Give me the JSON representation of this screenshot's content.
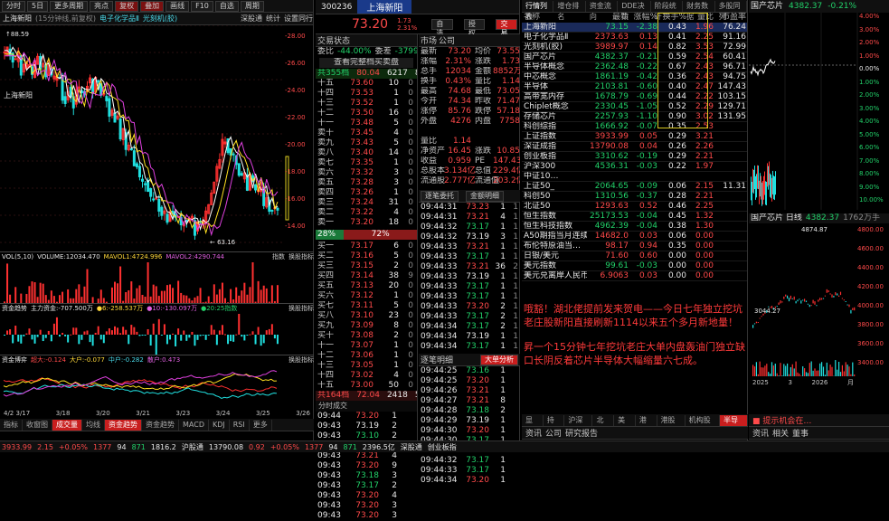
{
  "left": {
    "toolbar": [
      "分时",
      "5日",
      "更多周期",
      "亮点",
      "复权",
      "叠加",
      "画线",
      "F10",
      "自选",
      "周期"
    ],
    "info_tabs": [
      "上海新阳",
      "(15分钟线,前复权)",
      "电子化学品Ⅱ",
      "光刻机(胶)"
    ],
    "right_tabs": [
      "深股通",
      "统计",
      "设置同行",
      "周期"
    ],
    "price_label": "上海新阳",
    "hi_label": "↑88.59",
    "lo_label": "← 63.16",
    "price_axis": [
      "-28.00",
      "-26.00",
      "-24.00",
      "-22.00",
      "-20.00",
      "-18.00",
      "-16.00",
      "-14.00"
    ],
    "vol_header": {
      "a": "VOL(5,10)",
      "b": "VOLUME:12034.470",
      "c": "MAVOL1:4724.996",
      "d": "MAVOL2:4290.744",
      "e": "指数",
      "f": "换股指标"
    },
    "vol_axis": [
      "-10万",
      "-5万",
      "-50"
    ],
    "fund_header": {
      "a": "资金趋势",
      "b": "主力资金:-707.500万",
      "c": "●6:-258.537万",
      "d": "●10:-130.097万",
      "e": "●20:25指数",
      "f": "换股指标"
    },
    "fund_axis": [
      "-1500万",
      "-1000万",
      "-500万",
      "-1000万"
    ],
    "bs_header": {
      "a": "资金博弈",
      "b": "超大:-0.124",
      "c": "大户:-0.077",
      "d": "中户:-0.282",
      "e": "散户:0.473",
      "f": "换股指标"
    },
    "bs_axis": [
      "-0.5",
      "-0.0",
      "-0.5"
    ],
    "dates": [
      "4/2 3/17",
      "3/18",
      "3/20",
      "3/21",
      "3/23",
      "3/24",
      "3/25",
      "3/26"
    ],
    "bottom_tabs": [
      "指标",
      "收窗图",
      "成交量",
      "均线",
      "资金趋势",
      "资金趋势",
      "MACD",
      "KDJ",
      "RSI",
      "更多"
    ]
  },
  "mid": {
    "code": "300236",
    "name": "上海新阳",
    "price": "73.20",
    "chg": "1.73",
    "pct": "2.31%",
    "btn_self": "自选",
    "btn_warn": "授权",
    "btn_trade": "交易",
    "tabs": [
      "交易状态",
      "市场",
      "公司"
    ],
    "weibi": {
      "l": "委比",
      "v": "-44.00%",
      "l2": "委差",
      "v2": "-3799"
    },
    "check_btn": "查看完整档买卖盘",
    "total_sell": {
      "l": "共355档",
      "p": "80.04",
      "v": "6217",
      "n": "8"
    },
    "asks": [
      [
        "十五",
        "73.60",
        "10",
        "0"
      ],
      [
        "十四",
        "73.53",
        "1",
        "0"
      ],
      [
        "十三",
        "73.52",
        "1",
        "0"
      ],
      [
        "十二",
        "73.50",
        "16",
        "0"
      ],
      [
        "十一",
        "73.48",
        "5",
        "0"
      ],
      [
        "卖十",
        "73.45",
        "4",
        "0"
      ],
      [
        "卖九",
        "73.43",
        "5",
        "0"
      ],
      [
        "卖八",
        "73.40",
        "14",
        "0"
      ],
      [
        "卖七",
        "73.35",
        "1",
        "0"
      ],
      [
        "卖六",
        "73.32",
        "3",
        "0"
      ],
      [
        "卖五",
        "73.28",
        "3",
        "0"
      ],
      [
        "卖四",
        "73.26",
        "1",
        "0"
      ],
      [
        "卖三",
        "73.24",
        "31",
        "0"
      ],
      [
        "卖二",
        "73.22",
        "4",
        "0"
      ],
      [
        "卖一",
        "73.20",
        "18",
        "0"
      ]
    ],
    "ratio": {
      "a": "28%",
      "b": "72%"
    },
    "bids": [
      [
        "买一",
        "73.17",
        "6",
        "0"
      ],
      [
        "买二",
        "73.16",
        "5",
        "0"
      ],
      [
        "买三",
        "73.15",
        "2",
        "0"
      ],
      [
        "买四",
        "73.14",
        "38",
        "9"
      ],
      [
        "买五",
        "73.13",
        "20",
        "0"
      ],
      [
        "买六",
        "73.12",
        "1",
        "0"
      ],
      [
        "买七",
        "73.11",
        "5",
        "0"
      ],
      [
        "买八",
        "73.10",
        "23",
        "0"
      ],
      [
        "买九",
        "73.09",
        "8",
        "0"
      ],
      [
        "买十",
        "73.08",
        "2",
        "0"
      ],
      [
        "十一",
        "73.07",
        "1",
        "0"
      ],
      [
        "十二",
        "73.06",
        "1",
        "0"
      ],
      [
        "十三",
        "73.05",
        "1",
        "0"
      ],
      [
        "十四",
        "73.02",
        "4",
        "0"
      ],
      [
        "十五",
        "73.00",
        "50",
        "0"
      ]
    ],
    "total_buy": {
      "l": "共164档",
      "p": "72.04",
      "v": "2418",
      "n": "5"
    },
    "stats": [
      [
        "最新",
        "73.20",
        "均价",
        "73.55"
      ],
      [
        "涨幅",
        "2.31%",
        "涨跌",
        "1.73"
      ],
      [
        "总手",
        "12034",
        "金额",
        "8852万"
      ],
      [
        "换手",
        "0.43%",
        "量比",
        "1.14"
      ],
      [
        "最高",
        "74.68",
        "最低",
        "73.05"
      ],
      [
        "今开",
        "74.34",
        "昨收",
        "71.47"
      ],
      [
        "涨停",
        "85.76",
        "跌停",
        "57.18"
      ],
      [
        "外盘",
        "4276",
        "内盘",
        "7758"
      ],
      [
        "",
        "",
        "",
        ""
      ],
      [
        "量比",
        "1.14",
        "",
        ""
      ],
      [
        "净资产",
        "16.45",
        "涨跌",
        "10.85"
      ],
      [
        "收益",
        "0.959",
        "PE",
        "147.43"
      ],
      [
        "总股本",
        "3.134亿",
        "总值",
        "229.4亿"
      ],
      [
        "流通股",
        "2.777亿",
        "流通值",
        "203.2亿"
      ]
    ],
    "mid_tabs": [
      "逐笔委托",
      "金额明细"
    ],
    "ticks1": [
      [
        "09:44:31",
        "73.23",
        "1",
        "1"
      ],
      [
        "09:44:31",
        "73.21",
        "4",
        "1"
      ],
      [
        "09:44:32",
        "73.17",
        "1",
        "1"
      ],
      [
        "09:44:32",
        "73.19",
        "3",
        "1"
      ],
      [
        "09:44:33",
        "73.21",
        "1",
        "1"
      ],
      [
        "09:44:33",
        "73.17",
        "1",
        "1"
      ],
      [
        "09:44:33",
        "73.21",
        "36",
        "2"
      ],
      [
        "09:44:33",
        "73.19",
        "1",
        "1"
      ],
      [
        "09:44:33",
        "73.17",
        "1",
        "1"
      ],
      [
        "09:44:33",
        "73.17",
        "1",
        "1"
      ],
      [
        "09:44:33",
        "73.20",
        "2",
        "1"
      ],
      [
        "09:44:33",
        "73.17",
        "2",
        "1"
      ],
      [
        "09:44:34",
        "73.17",
        "2",
        "1"
      ],
      [
        "09:44:34",
        "73.19",
        "1",
        "1"
      ],
      [
        "09:44:34",
        "73.17",
        "1",
        "1"
      ]
    ],
    "tick2_hdr": "逐笔明细",
    "tick2_btn": "大单分析",
    "ticks2": [
      [
        "09:44:25",
        "73.16",
        "1"
      ],
      [
        "09:44:25",
        "73.20",
        "1"
      ],
      [
        "09:44:26",
        "73.21",
        "1"
      ],
      [
        "09:44:27",
        "73.21",
        "8"
      ],
      [
        "09:44:28",
        "73.18",
        "2"
      ],
      [
        "09:44:29",
        "73.19",
        "1"
      ],
      [
        "09:44:30",
        "73.20",
        "1"
      ],
      [
        "09:44:30",
        "73.17",
        "1"
      ],
      [
        "09:44:31",
        "73.21",
        "1"
      ],
      [
        "09:44:32",
        "73.17",
        "1"
      ],
      [
        "09:44:33",
        "73.17",
        "1"
      ],
      [
        "09:44:34",
        "73.20",
        "1"
      ]
    ],
    "fen_hdr": "分时成交",
    "fen": [
      [
        "09:44",
        "73.20",
        "1"
      ],
      [
        "09:43",
        "73.19",
        "2"
      ],
      [
        "09:43",
        "73.10",
        "2"
      ],
      [
        "09:43",
        "73.11",
        "2"
      ],
      [
        "09:43",
        "73.21",
        "4"
      ],
      [
        "09:43",
        "73.20",
        "9"
      ],
      [
        "09:43",
        "73.18",
        "3"
      ],
      [
        "09:43",
        "73.17",
        "2"
      ],
      [
        "09:43",
        "73.20",
        "4"
      ],
      [
        "09:43",
        "73.20",
        "3"
      ],
      [
        "09:43",
        "73.20",
        "3"
      ]
    ]
  },
  "rgt": {
    "tabs": [
      "行情列表",
      "增仓排名",
      "资金流向",
      "DDE决策",
      "阶段统计",
      "财务数据",
      "多股同列"
    ],
    "hdr": [
      "名称",
      "最新",
      "涨幅%",
      "换手%",
      "量比",
      "市盈率"
    ],
    "rows": [
      [
        "上海新阳",
        "73.15",
        "-2.38",
        "0.43",
        "1.96",
        "76.24"
      ],
      [
        "电子化学品Ⅱ",
        "2373.63",
        "0.13",
        "0.41",
        "2.25",
        "91.16"
      ],
      [
        "光刻机(胶)",
        "3989.97",
        "0.14",
        "0.82",
        "3.53",
        "72.99"
      ],
      [
        "国产芯片",
        "4382.37",
        "-0.21",
        "0.59",
        "2.54",
        "60.41"
      ],
      [
        "半导体概念",
        "2362.48",
        "-0.22",
        "0.67",
        "2.43",
        "96.71"
      ],
      [
        "中芯概念",
        "1861.19",
        "-0.42",
        "0.36",
        "2.43",
        "94.75"
      ],
      [
        "半导体",
        "2103.81",
        "-0.60",
        "0.40",
        "2.47",
        "147.43"
      ],
      [
        "高带宽内存",
        "1678.79",
        "-0.69",
        "0.44",
        "2.22",
        "103.15"
      ],
      [
        "Chiplet概念",
        "2330.45",
        "-1.05",
        "0.52",
        "2.29",
        "129.71"
      ],
      [
        "存储芯片",
        "2257.93",
        "-1.10",
        "0.90",
        "3.02",
        "131.95"
      ],
      [
        "科创综指",
        "1666.92",
        "-0.07",
        "0.35",
        "2.53",
        ""
      ],
      [
        "上证指数",
        "3933.99",
        "0.05",
        "0.29",
        "3.21",
        ""
      ],
      [
        "深证成指",
        "13790.08",
        "0.04",
        "0.26",
        "2.26",
        ""
      ],
      [
        "创业板指",
        "3310.62",
        "-0.19",
        "0.29",
        "2.21",
        ""
      ],
      [
        "沪深300",
        "4536.31",
        "-0.03",
        "0.22",
        "1.97",
        ""
      ],
      [
        "中证10…",
        "",
        "",
        "",
        "",
        ""
      ],
      [
        "上证50_",
        "2064.65",
        "-0.09",
        "0.06",
        "2.15",
        "11.31"
      ],
      [
        "科创50",
        "1310.56",
        "-0.37",
        "0.28",
        "2.21",
        ""
      ],
      [
        "北证50",
        "1293.63",
        "0.52",
        "0.46",
        "2.25",
        ""
      ],
      [
        "恒生指数",
        "25173.53",
        "-0.04",
        "0.45",
        "1.32",
        ""
      ],
      [
        "恒生科技指数",
        "4962.39",
        "-0.04",
        "0.38",
        "1.30",
        ""
      ],
      [
        "A50期指当月连续",
        "14682.0",
        "0.03",
        "0.06",
        "0.00",
        ""
      ],
      [
        "布伦特原油当…",
        "98.17",
        "0.94",
        "0.35",
        "0.00",
        ""
      ],
      [
        "日银/美元",
        "71.60",
        "0.60",
        "0.00",
        "0.00",
        ""
      ],
      [
        "美元指数",
        "99.61",
        "-0.03",
        "0.00",
        "0.00",
        ""
      ],
      [
        "美元兑离岸人民币",
        "6.9063",
        "0.03",
        "0.00",
        "0.00",
        ""
      ]
    ],
    "news1": "哦豁！湖北佬提前发来贺电——今日七年独立挖坑老庄股新阳直接刷新1114以来五个多月新地量！",
    "news2": "昇一个15分钟七年挖坑老庄大单内盘轰油门独立缺口长阴反着芯片半导体大幅缩量六七成。",
    "bottom_tabs": [
      "显示",
      "持仓",
      "沪深股",
      "北证",
      "美股",
      "港股",
      "港股通",
      "机构股票",
      "半导体",
      "光刻胶",
      "更多"
    ],
    "bottom_on": "半导体"
  },
  "far": {
    "header": {
      "name": "国产芯片",
      "price": "4382.37",
      "pct": "-0.21%"
    },
    "top_axis": [
      "4.00%",
      "3.00%",
      "2.00%",
      "1.00%",
      "0.00%",
      "1.00%",
      "2.00%",
      "3.00%",
      "4.00%",
      "5.00%",
      "6.00%",
      "7.00%",
      "8.00%",
      "9.00%",
      "10.00%"
    ],
    "k_header": {
      "name": "国产芯片 日线",
      "price": "4382.37",
      "info": "1762万手"
    },
    "k_axis": [
      "4800.00",
      "4600.00",
      "4400.00",
      "4200.00",
      "4000.00",
      "3800.00",
      "3600.00",
      "3400.00"
    ],
    "hi": "4874.87",
    "lo": "3044.27",
    "k_dates": [
      "2025",
      "3",
      "2026",
      "月"
    ],
    "tabs": [
      "资讯",
      "公司",
      "研究报告",
      "资讯",
      "相关",
      "董事"
    ],
    "bottom_tab": "■ 提示机会在…"
  },
  "status": {
    "a": {
      "l": "委托队列",
      "v": ""
    },
    "items": [
      "3933.99",
      "2.15",
      "+0.05%",
      "1377",
      "94",
      "871",
      "1816.2",
      "沪股通",
      "3",
      "上证",
      "13790.08",
      "0.92",
      "+0.05%",
      "1377",
      "94",
      "871",
      "2396.5亿",
      "深股通",
      "创业板指"
    ]
  }
}
